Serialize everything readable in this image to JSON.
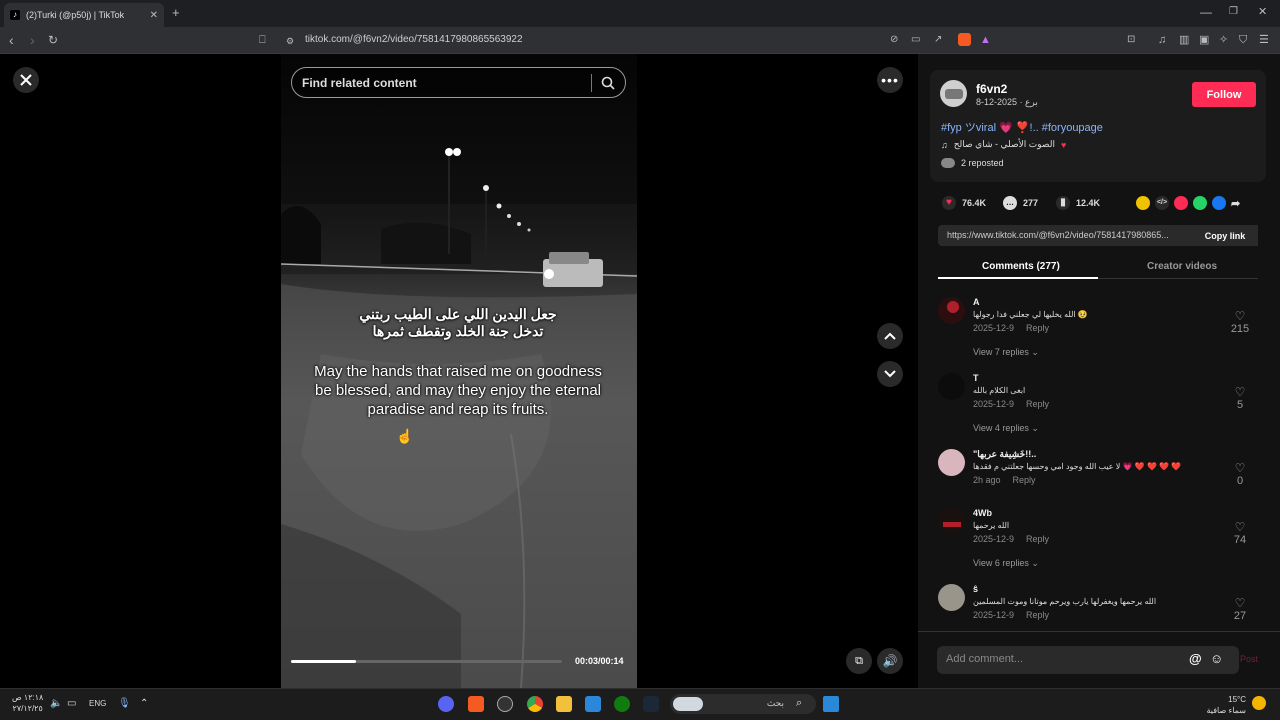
{
  "browser": {
    "tab_title": "(2)Turki (@p50j) | TikTok",
    "new_tab": "+",
    "url": "tiktok.com/@f6vn2/video/7581417980865563922"
  },
  "video": {
    "search_placeholder": "Find related content",
    "caption_ar_line1": "جعل اليدين اللي على الطيب ربتني",
    "caption_ar_line2": "تدخل جنة الخلد وتقطف ثمرها",
    "caption_en": "May the hands that raised me on goodness be blessed, and may they enjoy the eternal paradise and reap its fruits.",
    "time": "00:03/00:14",
    "progress": 0.24
  },
  "author": {
    "username": "f6vn2",
    "subtitle": "برع · 2025-12-8",
    "follow_label": "Follow",
    "description": "#fyp ツviral 💗 ❣️!.. #foryoupage",
    "music": "الصوت الأصلي - شاي صالح",
    "reposted": "2 reposted"
  },
  "stats": {
    "likes": "76.4K",
    "comments": "277",
    "saves": "12.4K"
  },
  "share": {
    "link": "https://www.tiktok.com/@f6vn2/video/7581417980865...",
    "copy_label": "Copy link"
  },
  "tabs": {
    "comments": "Comments (277)",
    "creator": "Creator videos"
  },
  "comments": [
    {
      "user": "A",
      "text": "الله يخليها لي جعلني فدا رجولها 🥹",
      "date": "2025-12-9",
      "reply": "Reply",
      "likes": "215",
      "replies": "View 7 replies ⌄"
    },
    {
      "user": "T",
      "text": "ابغى الكلام بالله",
      "date": "2025-12-9",
      "reply": "Reply",
      "likes": "5",
      "replies": "View 4 replies ⌄"
    },
    {
      "user": "\"خَشِيفة عربها!!..",
      "text": "لا عيب الله وجود امي وحسها جعلتني م فقدها 💗 ❤️ ❤️ ❤️ ❤️",
      "date": "2h ago",
      "reply": "Reply",
      "likes": "0",
      "replies": ""
    },
    {
      "user": "4Wb",
      "text": "الله يرحمها",
      "date": "2025-12-9",
      "reply": "Reply",
      "likes": "74",
      "replies": "View 6 replies ⌄"
    },
    {
      "user": "ŝ",
      "text": "الله يرحمها ويغفرلها يارب ويرحم موتانا وموت المسلمين",
      "date": "2025-12-9",
      "reply": "Reply",
      "likes": "27",
      "replies": ""
    }
  ],
  "add_comment": {
    "placeholder": "Add comment...",
    "at": "@",
    "post": "Post"
  },
  "taskbar": {
    "time": "١٢:١٨ ص",
    "date": "٢٧/١٢/٢٥",
    "lang": "ENG",
    "search": "بحث",
    "temp": "15°C",
    "weather": "سماء صافية"
  }
}
